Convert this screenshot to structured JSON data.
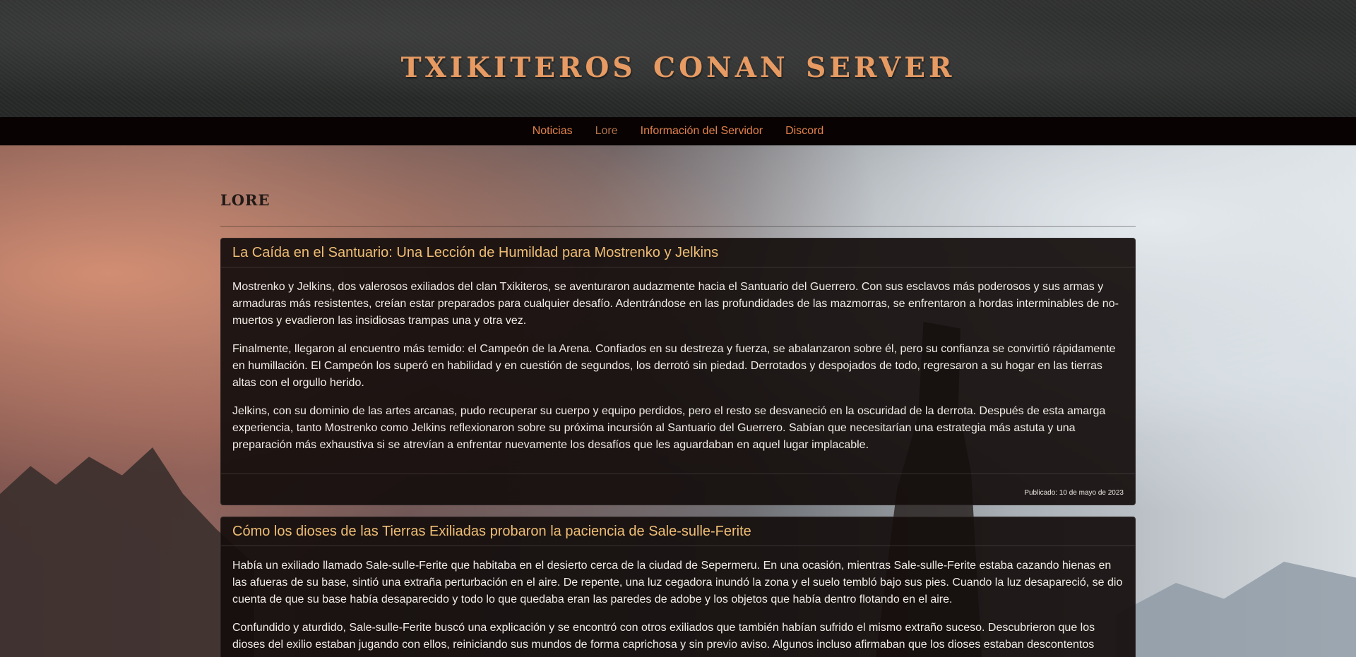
{
  "header": {
    "site_title": "Txikiteros Conan Server"
  },
  "nav": {
    "items": [
      {
        "label": "Noticias"
      },
      {
        "label": "Lore"
      },
      {
        "label": "Información del Servidor"
      },
      {
        "label": "Discord"
      }
    ],
    "active": "Lore"
  },
  "page": {
    "title": "Lore"
  },
  "posts": [
    {
      "title": "La Caída en el Santuario: Una Lección de Humildad para Mostrenko y Jelkins",
      "paragraphs": [
        "Mostrenko y Jelkins, dos valerosos exiliados del clan Txikiteros, se aventuraron audazmente hacia el Santuario del Guerrero. Con sus esclavos más poderosos y sus armas y armaduras más resistentes, creían estar preparados para cualquier desafío. Adentrándose en las profundidades de las mazmorras, se enfrentaron a hordas interminables de no-muertos y evadieron las insidiosas trampas una y otra vez.",
        "Finalmente, llegaron al encuentro más temido: el Campeón de la Arena. Confiados en su destreza y fuerza, se abalanzaron sobre él, pero su confianza se convirtió rápidamente en humillación. El Campeón los superó en habilidad y en cuestión de segundos, los derrotó sin piedad. Derrotados y despojados de todo, regresaron a su hogar en las tierras altas con el orgullo herido.",
        "Jelkins, con su dominio de las artes arcanas, pudo recuperar su cuerpo y equipo perdidos, pero el resto se desvaneció en la oscuridad de la derrota. Después de esta amarga experiencia, tanto Mostrenko como Jelkins reflexionaron sobre su próxima incursión al Santuario del Guerrero. Sabían que necesitarían una estrategia más astuta y una preparación más exhaustiva si se atrevían a enfrentar nuevamente los desafíos que les aguardaban en aquel lugar implacable."
      ],
      "date": "Publicado: 10 de mayo de 2023"
    },
    {
      "title": "Cómo los dioses de las Tierras Exiliadas probaron la paciencia de Sale-sulle-Ferite",
      "paragraphs": [
        "Había un exiliado llamado Sale-sulle-Ferite que habitaba en el desierto cerca de la ciudad de Sepermeru. En una ocasión, mientras Sale-sulle-Ferite estaba cazando hienas en las afueras de su base, sintió una extraña perturbación en el aire. De repente, una luz cegadora inundó la zona y el suelo tembló bajo sus pies. Cuando la luz desapareció, se dio cuenta de que su base había desaparecido y todo lo que quedaba eran las paredes de adobe y los objetos que había dentro flotando en el aire.",
        "Confundido y aturdido, Sale-sulle-Ferite buscó una explicación y se encontró con otros exiliados que también habían sufrido el mismo extraño suceso. Descubrieron que los dioses del exilio estaban jugando con ellos, reiniciando sus mundos de forma caprichosa y sin previo aviso. Algunos incluso afirmaban que los dioses estaban descontentos"
      ]
    }
  ],
  "colors": {
    "title_orange": "#e79b63",
    "nav_link": "#e4804b",
    "card_title": "#efbe74",
    "card_bg": "#140e0d"
  }
}
